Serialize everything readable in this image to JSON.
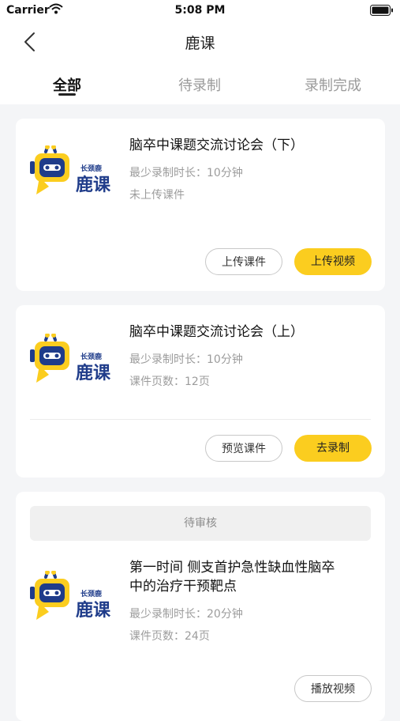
{
  "status_bar": {
    "carrier": "Carrier",
    "time": "5:08 PM"
  },
  "nav": {
    "title": "鹿课"
  },
  "tabs": [
    {
      "label": "全部",
      "active": true
    },
    {
      "label": "待录制",
      "active": false
    },
    {
      "label": "录制完成",
      "active": false
    }
  ],
  "logo": {
    "brand_small": "长颈鹿",
    "brand_main": "鹿课"
  },
  "courses": [
    {
      "title": "脑卒中课题交流讨论会（下）",
      "min_duration": "最少录制时长：10分钟",
      "info": "未上传课件",
      "buttons": [
        "上传课件",
        "上传视频"
      ]
    },
    {
      "title": "脑卒中课题交流讨论会（上）",
      "min_duration": "最少录制时长：10分钟",
      "info": "课件页数：12页",
      "buttons": [
        "预览课件",
        "去录制"
      ]
    },
    {
      "status": "待审核",
      "title_line1": "第一时间 侧支首护急性缺血性脑卒",
      "title_line2": "中的治疗干预靶点",
      "min_duration": "最少录制时长：20分钟",
      "info": "课件页数：24页",
      "buttons": [
        "播放视频"
      ]
    }
  ],
  "colors": {
    "accent": "#fbcd1f",
    "logo_blue": "#1f3c8a",
    "background": "#f4f5f7"
  },
  "icons": [
    "wifi-icon",
    "battery-icon",
    "back-chevron-icon",
    "robot-logo-icon"
  ]
}
